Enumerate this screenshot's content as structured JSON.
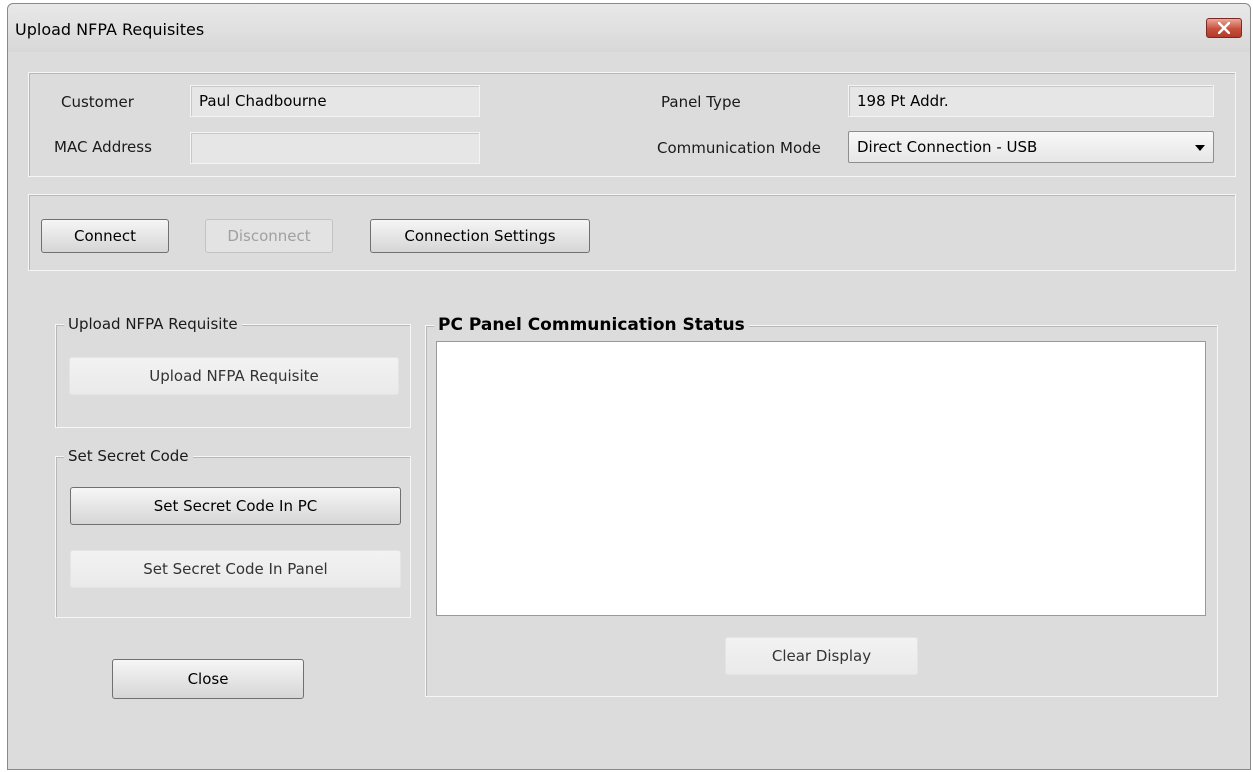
{
  "window": {
    "title": "Upload NFPA Requisites",
    "close_icon": "close-x-icon"
  },
  "top_form": {
    "customer_label": "Customer",
    "customer_value": "Paul Chadbourne",
    "mac_label": "MAC Address",
    "mac_value": "",
    "panel_type_label": "Panel Type",
    "panel_type_value": "198 Pt Addr.",
    "comm_mode_label": "Communication Mode",
    "comm_mode_value": "Direct Connection - USB"
  },
  "connection": {
    "connect": "Connect",
    "disconnect": "Disconnect",
    "settings": "Connection Settings"
  },
  "upload_group": {
    "caption": "Upload NFPA Requisite",
    "button": "Upload NFPA Requisite"
  },
  "secret_group": {
    "caption": "Set Secret Code",
    "pc_button": "Set Secret Code In PC",
    "panel_button": "Set Secret Code In Panel"
  },
  "status_group": {
    "caption": "PC Panel Communication Status",
    "content": "",
    "clear_button": "Clear Display"
  },
  "footer": {
    "close": "Close"
  }
}
